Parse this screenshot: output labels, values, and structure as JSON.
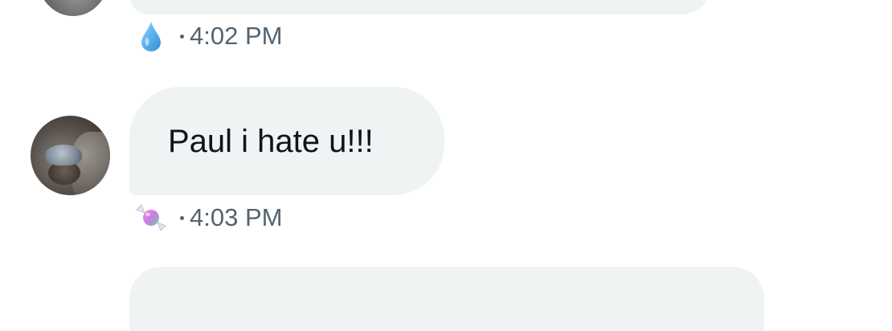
{
  "messages": [
    {
      "reaction_icon": "droplet-icon",
      "time": "4:02 PM"
    },
    {
      "text": "Paul i hate u!!!",
      "reaction_icon": "candy-icon",
      "time": "4:03 PM"
    }
  ],
  "colors": {
    "bubble": "#eff3f4",
    "text": "#0f1419",
    "meta": "#536471",
    "droplet": "#4aa8e8"
  }
}
